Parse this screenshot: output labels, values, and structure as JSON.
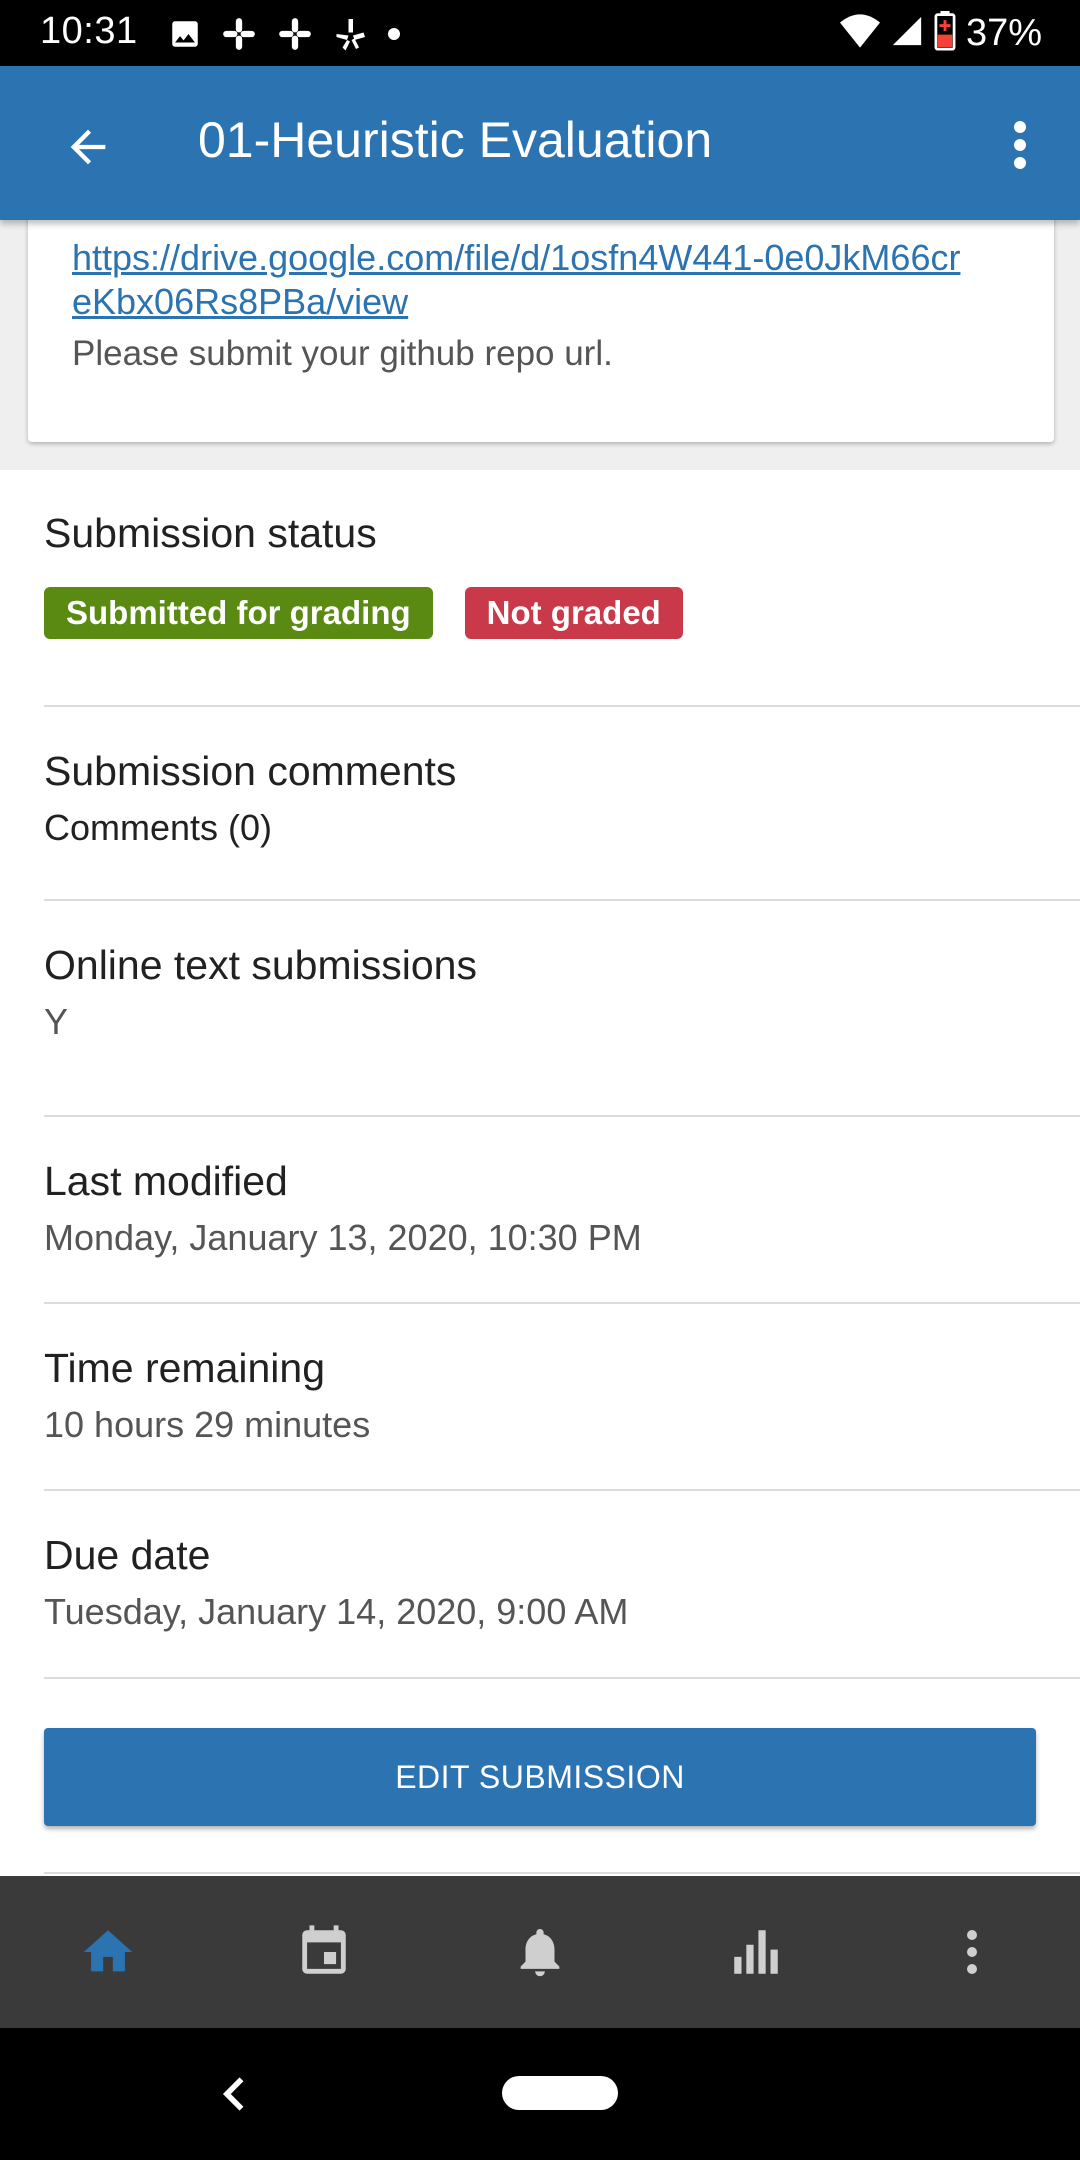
{
  "status_bar": {
    "time": "10:31",
    "battery_percent": "37%",
    "icons": [
      "image-icon",
      "slack-icon",
      "slack-icon",
      "yelp-icon",
      "dot-icon",
      "wifi-icon",
      "cell-signal-icon",
      "battery-low-icon"
    ]
  },
  "app_bar": {
    "title": "01-Heuristic Evaluation",
    "back_icon": "arrow-left-icon",
    "menu_icon": "more-vert-icon"
  },
  "description": {
    "link": "https://drive.google.com/file/d/1osfn4W441-0e0JkM66creKbx06Rs8PBa/view",
    "text": "Please submit your github repo url."
  },
  "submission_status": {
    "title": "Submission status",
    "badges": [
      {
        "label": "Submitted for grading",
        "color": "#5b8a12"
      },
      {
        "label": "Not graded",
        "color": "#c9394a"
      }
    ]
  },
  "submission_comments": {
    "title": "Submission comments",
    "link": "Comments (0)"
  },
  "online_text": {
    "title": "Online text submissions",
    "value": "Y"
  },
  "last_modified": {
    "title": "Last modified",
    "value": "Monday, January 13, 2020, 10:30 PM"
  },
  "time_remaining": {
    "title": "Time remaining",
    "value": "10 hours 29 minutes"
  },
  "due_date": {
    "title": "Due date",
    "value": "Tuesday, January 14, 2020, 9:00 AM"
  },
  "edit_button": {
    "label": "EDIT SUBMISSION"
  },
  "tab_bar": {
    "tabs": [
      "home-icon",
      "calendar-icon",
      "bell-icon",
      "grades-chart-icon",
      "more-vert-icon"
    ],
    "active_color": "#2b73b1",
    "inactive_color": "#cfcfcf"
  }
}
